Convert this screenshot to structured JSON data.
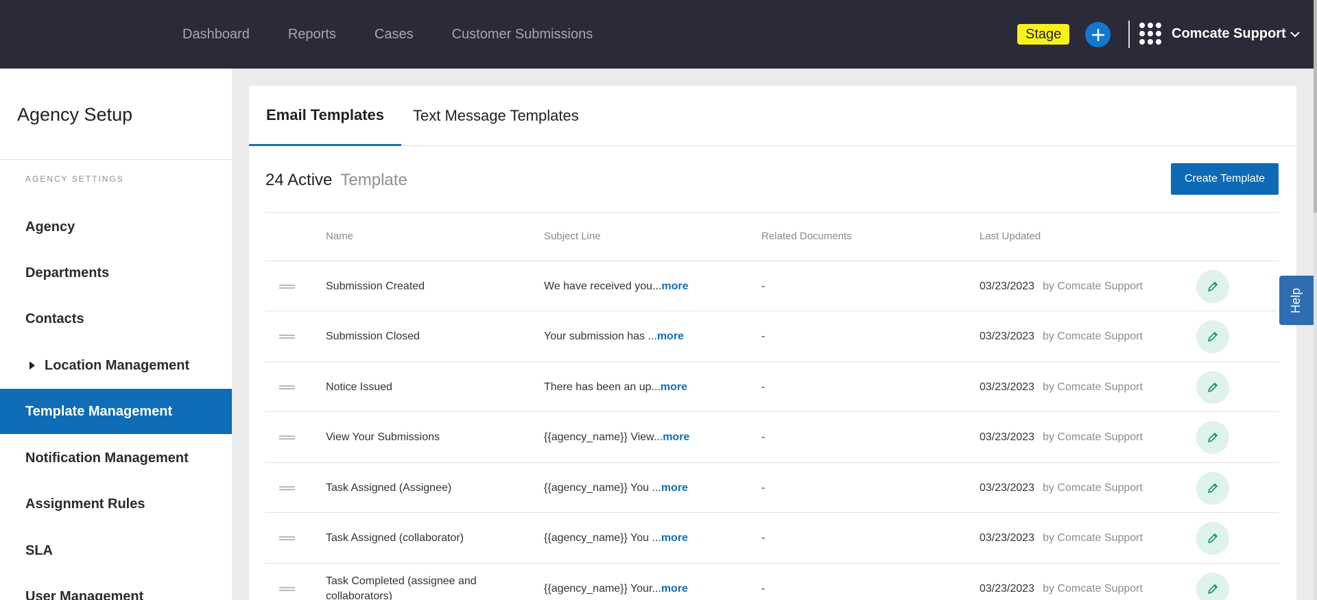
{
  "topbar": {
    "nav": [
      "Dashboard",
      "Reports",
      "Cases",
      "Customer Submissions"
    ],
    "stage_badge": "Stage",
    "account_name": "Comcate Support",
    "icons": [
      "plus-icon",
      "app-grid-icon",
      "chevron-down-icon"
    ]
  },
  "sidebar": {
    "title": "Agency Setup",
    "section_label": "AGENCY SETTINGS",
    "items": [
      {
        "label": "Agency"
      },
      {
        "label": "Departments"
      },
      {
        "label": "Contacts"
      },
      {
        "label": "Location Management"
      },
      {
        "label": "Template Management",
        "active": true
      },
      {
        "label": "Notification Management"
      },
      {
        "label": "Assignment Rules"
      },
      {
        "label": "SLA"
      },
      {
        "label": "User Management"
      }
    ]
  },
  "main": {
    "tabs": [
      {
        "label": "Email Templates",
        "active": true
      },
      {
        "label": "Text Message Templates"
      }
    ],
    "count_label": "24 Active",
    "count_suffix": "Template",
    "create_button": "Create Template",
    "columns": [
      "Name",
      "Subject Line",
      "Related Documents",
      "Last Updated"
    ],
    "rows": [
      {
        "name": "Submission Created",
        "subject": "We have received you...",
        "more": "more",
        "related": "-",
        "date": "03/23/2023",
        "by": "by Comcate Support"
      },
      {
        "name": "Submission Closed",
        "subject": "Your submission has ...",
        "more": "more",
        "related": "-",
        "date": "03/23/2023",
        "by": "by Comcate Support"
      },
      {
        "name": "Notice Issued",
        "subject": "There has been an up...",
        "more": "more",
        "related": "-",
        "date": "03/23/2023",
        "by": "by Comcate Support"
      },
      {
        "name": "View Your Submissions",
        "subject": "{{agency_name}} View...",
        "more": "more",
        "related": "-",
        "date": "03/23/2023",
        "by": "by Comcate Support"
      },
      {
        "name": "Task Assigned (Assignee)",
        "subject": "{{agency_name}} You ...",
        "more": "more",
        "related": "-",
        "date": "03/23/2023",
        "by": "by Comcate Support"
      },
      {
        "name": "Task Assigned (collaborator)",
        "subject": "{{agency_name}} You ...",
        "more": "more",
        "related": "-",
        "date": "03/23/2023",
        "by": "by Comcate Support"
      },
      {
        "name": "Task Completed (assignee and collaborators)",
        "subject": "{{agency_name}} Your...",
        "more": "more",
        "related": "-",
        "date": "03/23/2023",
        "by": "by Comcate Support"
      }
    ]
  },
  "help_tab": "Help",
  "colors": {
    "topbar": "#2b2a38",
    "accent": "#0f6cb6",
    "stage": "#f7f21b",
    "edit_bg": "#dff2eb",
    "edit_icon": "#1e9b6b"
  }
}
